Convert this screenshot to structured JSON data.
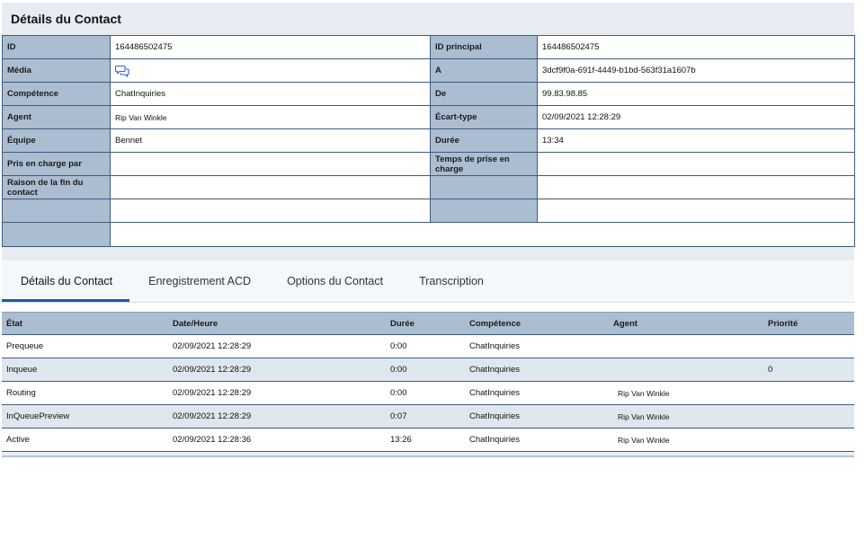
{
  "title": "Détails du Contact",
  "info_rows": [
    {
      "l1": "ID",
      "v1": "164486502475",
      "l2": "ID principal",
      "v2": "164486502475"
    },
    {
      "l1": "Média",
      "v1": "",
      "l2": "A",
      "v2": "3dcf9f0a-691f-4449-b1bd-563f31a1607b"
    },
    {
      "l1": "Compétence",
      "v1": "ChatInquiries",
      "l2": "De",
      "v2": "99.83.98.85"
    },
    {
      "l1": "Agent",
      "v1": "Rip Van Winkle",
      "l2": "Écart-type",
      "v2": "02/09/2021 12:28:29"
    },
    {
      "l1": "Équipe",
      "v1": "Bennet",
      "l2": "Durée",
      "v2": "13:34"
    },
    {
      "l1": "Pris en charge par",
      "v1": "",
      "l2": "Temps de prise en charge",
      "v2": ""
    },
    {
      "l1": "Raison de la fin du contact",
      "v1": "",
      "l2": "",
      "v2": ""
    },
    {
      "l1": "",
      "v1": "",
      "l2": "",
      "v2": ""
    },
    {
      "l1": "",
      "v1": ""
    }
  ],
  "media_icon": "chat-bubbles-icon",
  "tabs": [
    "Détails du Contact",
    "Enregistrement ACD",
    "Options du Contact",
    "Transcription"
  ],
  "states_table": {
    "headers": [
      "État",
      "Date/Heure",
      "Durée",
      "Compétence",
      "Agent",
      "Priorité"
    ],
    "rows": [
      {
        "etat": "Prequeue",
        "date": "02/09/2021 12:28:29",
        "duree": "0:00",
        "competence": "ChatInquiries",
        "agent": "",
        "priorite": ""
      },
      {
        "etat": "Inqueue",
        "date": "02/09/2021 12:28:29",
        "duree": "0:00",
        "competence": "ChatInquiries",
        "agent": "",
        "priorite": "0"
      },
      {
        "etat": "Routing",
        "date": "02/09/2021 12:28:29",
        "duree": "0:00",
        "competence": "ChatInquiries",
        "agent": "Rip Van Winkle",
        "priorite": ""
      },
      {
        "etat": "InQueuePreview",
        "date": "02/09/2021 12:28:29",
        "duree": "0:07",
        "competence": "ChatInquiries",
        "agent": "Rip Van Winkle",
        "priorite": ""
      },
      {
        "etat": "Active",
        "date": "02/09/2021 12:28:36",
        "duree": "13:26",
        "competence": "ChatInquiries",
        "agent": "Rip Van Winkle",
        "priorite": ""
      }
    ]
  }
}
